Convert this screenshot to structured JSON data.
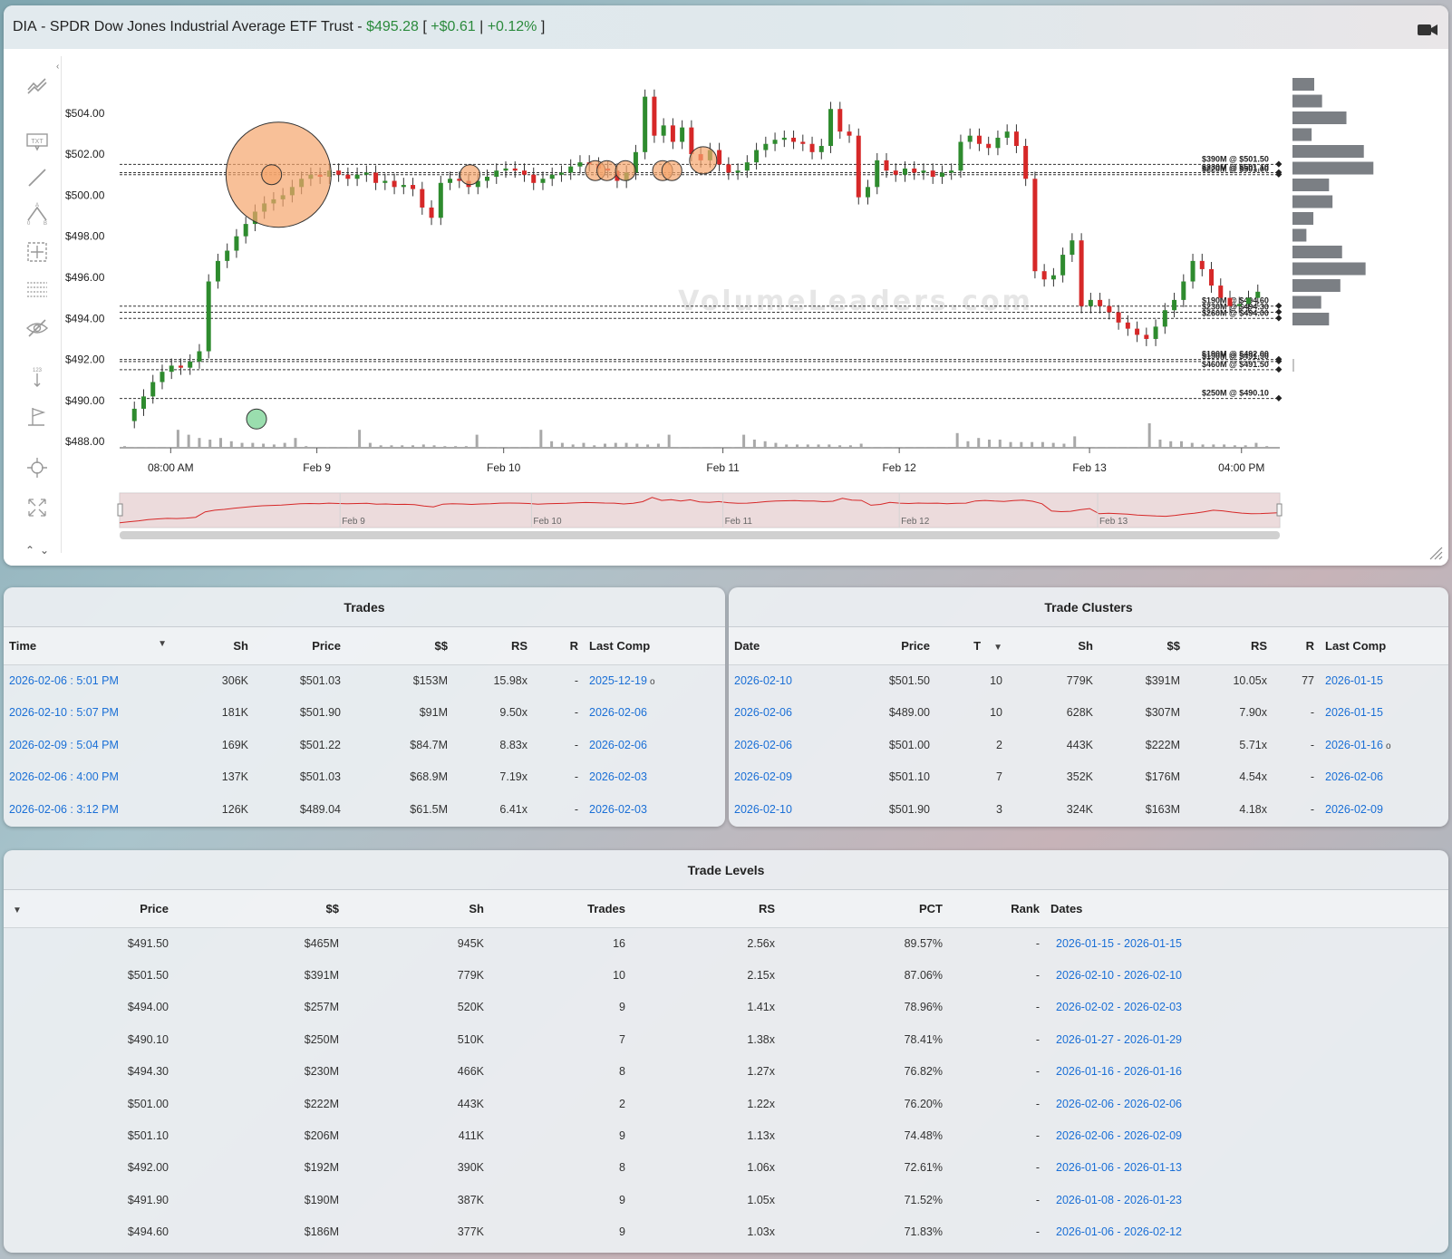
{
  "header": {
    "ticker": "DIA",
    "separator": " - ",
    "name": "SPDR Dow Jones Industrial Average ETF Trust",
    "separator2": " - ",
    "price": "$495.28",
    "bracket_open": " [ ",
    "change": "+$0.61",
    "pipe": " | ",
    "change_pct": "+0.12%",
    "bracket_close": " ]"
  },
  "toolbar": {
    "icons": [
      "trend-lines-icon",
      "text-annotation-icon",
      "line-draw-icon",
      "pattern-abcd-icon",
      "crosshair-box-icon",
      "fib-grid-icon",
      "hide-drawings-icon",
      "price-range-icon",
      "flag-marker-icon",
      "zoom-target-icon",
      "fullscreen-icon"
    ]
  },
  "chart_data": {
    "type": "candlestick",
    "watermark": "VolumeLeaders.com",
    "y_ticks": [
      "$504.00",
      "$502.00",
      "$500.00",
      "$498.00",
      "$496.00",
      "$494.00",
      "$492.00",
      "$490.00",
      "$488.00"
    ],
    "ylim": [
      487.7,
      505.8
    ],
    "x_ticks": [
      "08:00 AM",
      "Feb 9",
      "Feb 10",
      "Feb 11",
      "Feb 12",
      "Feb 13",
      "04:00 PM"
    ],
    "levels": [
      {
        "label": "$390M @ $501.50",
        "price": 501.5
      },
      {
        "label": "$230M @ $501.10",
        "price": 501.1
      },
      {
        "label": "$220M @ $501.00",
        "price": 501.0
      },
      {
        "label": "$190M @ $494.60",
        "price": 494.6
      },
      {
        "label": "$230M @ $494.30",
        "price": 494.3
      },
      {
        "label": "$260M @ $494.00",
        "price": 494.0
      },
      {
        "label": "$190M @ $492.00",
        "price": 492.0
      },
      {
        "label": "$190M @ $491.90",
        "price": 491.9
      },
      {
        "label": "$460M @ $491.50",
        "price": 491.5
      },
      {
        "label": "$250M @ $490.10",
        "price": 490.1
      }
    ],
    "price_path": [
      489.0,
      489.6,
      490.2,
      490.9,
      491.4,
      491.7,
      491.6,
      491.9,
      492.4,
      495.8,
      496.8,
      497.3,
      498.0,
      498.6,
      499.2,
      499.6,
      499.8,
      500.0,
      500.4,
      500.8,
      501.0,
      500.9,
      501.2,
      501.0,
      500.8,
      501.0,
      501.1,
      500.6,
      500.7,
      500.4,
      500.5,
      500.3,
      499.4,
      498.9,
      500.6,
      500.8,
      500.7,
      500.4,
      500.7,
      500.9,
      501.2,
      501.3,
      501.2,
      501.0,
      500.6,
      500.8,
      501.0,
      501.1,
      501.4,
      501.6,
      501.5,
      501.3,
      501.2,
      500.7,
      501.1,
      502.1,
      504.8,
      502.9,
      503.4,
      502.6,
      503.3,
      502.0,
      501.7,
      502.2,
      501.5,
      501.1,
      501.2,
      501.6,
      502.2,
      502.5,
      502.7,
      502.8,
      502.6,
      502.5,
      502.1,
      502.4,
      504.2,
      503.1,
      502.9,
      499.9,
      500.4,
      501.7,
      501.2,
      501.0,
      501.3,
      501.1,
      501.2,
      500.9,
      501.1,
      501.2,
      502.6,
      502.9,
      502.5,
      502.3,
      502.8,
      503.1,
      502.4,
      500.8,
      496.3,
      495.9,
      496.1,
      497.1,
      497.8,
      494.6,
      494.9,
      494.6,
      494.3,
      493.8,
      493.5,
      493.2,
      493.0,
      493.6,
      494.4,
      494.9,
      495.8,
      496.8,
      496.4,
      495.6,
      495.0,
      494.6,
      494.7,
      495.0,
      495.3
    ],
    "volume": [
      2,
      1,
      1,
      1,
      1,
      22,
      16,
      12,
      10,
      12,
      8,
      6,
      6,
      5,
      4,
      6,
      12,
      2,
      1,
      1,
      1,
      1,
      22,
      6,
      3,
      3,
      3,
      3,
      4,
      3,
      2,
      2,
      2,
      16,
      1,
      1,
      1,
      1,
      1,
      22,
      8,
      6,
      4,
      6,
      3,
      5,
      6,
      6,
      5,
      4,
      5,
      16,
      1,
      1,
      1,
      1,
      1,
      1,
      16,
      10,
      8,
      6,
      4,
      4,
      4,
      4,
      4,
      3,
      3,
      5,
      1,
      1,
      1,
      1,
      1,
      1,
      1,
      1,
      18,
      8,
      12,
      10,
      10,
      7,
      7,
      7,
      7,
      6,
      5,
      14,
      1,
      1,
      1,
      1,
      1,
      1,
      30,
      10,
      8,
      8,
      6,
      4,
      4,
      4,
      3,
      3,
      6,
      2
    ],
    "bubbles": [
      {
        "price": 501.0,
        "size": "xl",
        "color": "orange",
        "pos": 0.137
      },
      {
        "price": 501.0,
        "size": "s",
        "color": "orange",
        "pos": 0.131
      },
      {
        "price": 501.0,
        "size": "s",
        "color": "orange",
        "pos": 0.302
      },
      {
        "price": 501.2,
        "size": "s",
        "color": "orange",
        "pos": 0.41
      },
      {
        "price": 501.2,
        "size": "s",
        "color": "orange",
        "pos": 0.42
      },
      {
        "price": 501.2,
        "size": "s",
        "color": "orange",
        "pos": 0.436
      },
      {
        "price": 501.2,
        "size": "s",
        "color": "orange",
        "pos": 0.468
      },
      {
        "price": 501.2,
        "size": "s",
        "color": "orange",
        "pos": 0.476
      },
      {
        "price": 501.7,
        "size": "m",
        "color": "orange",
        "pos": 0.503
      },
      {
        "price": 489.1,
        "size": "s",
        "color": "green",
        "pos": 0.118
      }
    ],
    "volume_profile": [
      0.25,
      0.34,
      0.62,
      0.22,
      0.82,
      0.93,
      0.42,
      0.46,
      0.24,
      0.16,
      0.57,
      0.84,
      0.55,
      0.33,
      0.42
    ]
  },
  "navigator": {
    "labels": [
      "Feb 9",
      "Feb 10",
      "Feb 11",
      "Feb 12",
      "Feb 13"
    ]
  },
  "trades": {
    "title": "Trades",
    "columns": [
      "Time",
      "Sh",
      "Price",
      "$$",
      "RS",
      "R",
      "Last Comp"
    ],
    "rows": [
      {
        "time": "2026-02-06 : 5:01 PM",
        "sh": "306K",
        "price": "$501.03",
        "dollars": "$153M",
        "rs": "15.98x",
        "r": "-",
        "last": "2025-12-19",
        "dot": "o"
      },
      {
        "time": "2026-02-10 : 5:07 PM",
        "sh": "181K",
        "price": "$501.90",
        "dollars": "$91M",
        "rs": "9.50x",
        "r": "-",
        "last": "2026-02-06",
        "dot": ""
      },
      {
        "time": "2026-02-09 : 5:04 PM",
        "sh": "169K",
        "price": "$501.22",
        "dollars": "$84.7M",
        "rs": "8.83x",
        "r": "-",
        "last": "2026-02-06",
        "dot": ""
      },
      {
        "time": "2026-02-06 : 4:00 PM",
        "sh": "137K",
        "price": "$501.03",
        "dollars": "$68.9M",
        "rs": "7.19x",
        "r": "-",
        "last": "2026-02-03",
        "dot": ""
      },
      {
        "time": "2026-02-06 : 3:12 PM",
        "sh": "126K",
        "price": "$489.04",
        "dollars": "$61.5M",
        "rs": "6.41x",
        "r": "-",
        "last": "2026-02-03",
        "dot": ""
      }
    ]
  },
  "clusters": {
    "title": "Trade Clusters",
    "columns": [
      "Date",
      "Price",
      "T",
      "Sh",
      "$$",
      "RS",
      "R",
      "Last Comp"
    ],
    "rows": [
      {
        "date": "2026-02-10",
        "price": "$501.50",
        "t": "10",
        "sh": "779K",
        "dollars": "$391M",
        "rs": "10.05x",
        "r": "77",
        "last": "2026-01-15",
        "dot": ""
      },
      {
        "date": "2026-02-06",
        "price": "$489.00",
        "t": "10",
        "sh": "628K",
        "dollars": "$307M",
        "rs": "7.90x",
        "r": "-",
        "last": "2026-01-15",
        "dot": ""
      },
      {
        "date": "2026-02-06",
        "price": "$501.00",
        "t": "2",
        "sh": "443K",
        "dollars": "$222M",
        "rs": "5.71x",
        "r": "-",
        "last": "2026-01-16",
        "dot": "o"
      },
      {
        "date": "2026-02-09",
        "price": "$501.10",
        "t": "7",
        "sh": "352K",
        "dollars": "$176M",
        "rs": "4.54x",
        "r": "-",
        "last": "2026-02-06",
        "dot": ""
      },
      {
        "date": "2026-02-10",
        "price": "$501.90",
        "t": "3",
        "sh": "324K",
        "dollars": "$163M",
        "rs": "4.18x",
        "r": "-",
        "last": "2026-02-09",
        "dot": ""
      }
    ]
  },
  "levels": {
    "title": "Trade Levels",
    "columns": [
      "Price",
      "$$",
      "Sh",
      "Trades",
      "RS",
      "PCT",
      "Rank",
      "Dates"
    ],
    "rows": [
      {
        "price": "$491.50",
        "dollars": "$465M",
        "sh": "945K",
        "trades": "16",
        "rs": "2.56x",
        "pct": "89.57%",
        "rank": "-",
        "dates": "2026-01-15 - 2026-01-15"
      },
      {
        "price": "$501.50",
        "dollars": "$391M",
        "sh": "779K",
        "trades": "10",
        "rs": "2.15x",
        "pct": "87.06%",
        "rank": "-",
        "dates": "2026-02-10 - 2026-02-10"
      },
      {
        "price": "$494.00",
        "dollars": "$257M",
        "sh": "520K",
        "trades": "9",
        "rs": "1.41x",
        "pct": "78.96%",
        "rank": "-",
        "dates": "2026-02-02 - 2026-02-03"
      },
      {
        "price": "$490.10",
        "dollars": "$250M",
        "sh": "510K",
        "trades": "7",
        "rs": "1.38x",
        "pct": "78.41%",
        "rank": "-",
        "dates": "2026-01-27 - 2026-01-29"
      },
      {
        "price": "$494.30",
        "dollars": "$230M",
        "sh": "466K",
        "trades": "8",
        "rs": "1.27x",
        "pct": "76.82%",
        "rank": "-",
        "dates": "2026-01-16 - 2026-01-16"
      },
      {
        "price": "$501.00",
        "dollars": "$222M",
        "sh": "443K",
        "trades": "2",
        "rs": "1.22x",
        "pct": "76.20%",
        "rank": "-",
        "dates": "2026-02-06 - 2026-02-06"
      },
      {
        "price": "$501.10",
        "dollars": "$206M",
        "sh": "411K",
        "trades": "9",
        "rs": "1.13x",
        "pct": "74.48%",
        "rank": "-",
        "dates": "2026-02-06 - 2026-02-09"
      },
      {
        "price": "$492.00",
        "dollars": "$192M",
        "sh": "390K",
        "trades": "8",
        "rs": "1.06x",
        "pct": "72.61%",
        "rank": "-",
        "dates": "2026-01-06 - 2026-01-13"
      },
      {
        "price": "$491.90",
        "dollars": "$190M",
        "sh": "387K",
        "trades": "9",
        "rs": "1.05x",
        "pct": "71.52%",
        "rank": "-",
        "dates": "2026-01-08 - 2026-01-23"
      },
      {
        "price": "$494.60",
        "dollars": "$186M",
        "sh": "377K",
        "trades": "9",
        "rs": "1.03x",
        "pct": "71.83%",
        "rank": "-",
        "dates": "2026-01-06 - 2026-02-12"
      }
    ]
  },
  "colors": {
    "up": "#2e8b2e",
    "down": "#d62828",
    "link": "#1a6fd6",
    "bubble_orange": "#f5a56c",
    "bubble_green": "#6fd08c",
    "profile": "#7b7f84"
  }
}
